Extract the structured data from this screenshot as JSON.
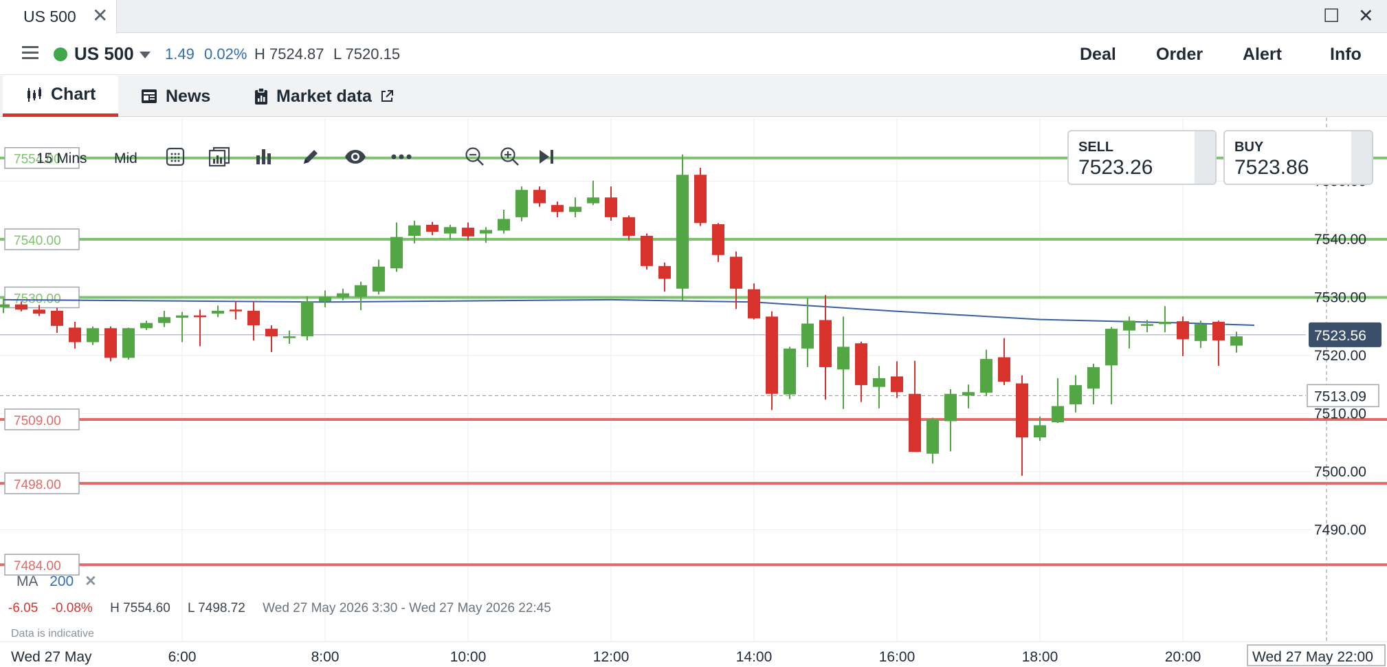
{
  "window": {
    "tab_title": "US 500",
    "close_glyph": "✕",
    "maximize_glyph": "☐",
    "close_window_glyph": "✕"
  },
  "instrument": {
    "name": "US 500",
    "status_color": "#3fa74a",
    "change": "1.49",
    "change_pct": "0.02%",
    "high_text": "H 7524.87",
    "low_text": "L 7520.15"
  },
  "actions": [
    "Deal",
    "Order",
    "Alert",
    "Info"
  ],
  "tabs": [
    {
      "label": "Chart",
      "icon": "candlestick-icon",
      "active": true
    },
    {
      "label": "News",
      "icon": "newspaper-icon",
      "active": false
    },
    {
      "label": "Market data",
      "icon": "market-data-icon",
      "active": false,
      "external": true
    }
  ],
  "toolbar": {
    "interval": "15 Mins",
    "price_type": "Mid",
    "icons": [
      "calculator-icon",
      "compare-icon",
      "chart-type-icon",
      "draw-pencil-icon",
      "visibility-eye-icon",
      "more-icon",
      "zoom-out-icon",
      "zoom-in-icon",
      "skip-to-end-icon"
    ]
  },
  "quote": {
    "sell_label": "SELL",
    "sell_value": "7523.26",
    "buy_label": "BUY",
    "buy_value": "7523.86"
  },
  "legend": {
    "ma_label": "MA",
    "ma_period": "200",
    "remove_glyph": "✕",
    "range_change": "-6.05",
    "range_change_pct": "-0.08%",
    "range_high": "H 7554.60",
    "range_low": "L 7498.72",
    "range_text": "Wed 27 May 2026 3:30 - Wed 27 May 2026 22:45",
    "indicative_note": "Data is indicative"
  },
  "chart_data": {
    "type": "candlestick",
    "interval": "15 Mins",
    "x_ticks": [
      "6:00",
      "8:00",
      "10:00",
      "12:00",
      "14:00",
      "16:00",
      "18:00",
      "20:00"
    ],
    "x_start_label": "Wed 27 May",
    "x_end_label": "Wed 27 May 22:00",
    "y_ticks": [
      7490,
      7500,
      7510,
      7520,
      7530,
      7540,
      7550
    ],
    "ylim": [
      7481,
      7558
    ],
    "current_price": 7523.56,
    "crosshair_price": 7513.09,
    "grid": true,
    "colors": {
      "up": "#52a644",
      "down": "#d8322d",
      "ma": "#3a5fa0",
      "support": "#e06a66",
      "resistance": "#7ec26f"
    },
    "level_lines": [
      {
        "value": 7554.0,
        "label": "7554.00",
        "kind": "resistance"
      },
      {
        "value": 7540.0,
        "label": "7540.00",
        "kind": "resistance"
      },
      {
        "value": 7530.0,
        "label": "7530.00",
        "kind": "resistance"
      },
      {
        "value": 7509.0,
        "label": "7509.00",
        "kind": "support"
      },
      {
        "value": 7498.0,
        "label": "7498.00",
        "kind": "support"
      },
      {
        "value": 7484.0,
        "label": "7484.00",
        "kind": "support"
      }
    ],
    "ma_200": [
      {
        "t": "3:30",
        "v": 7529.6
      },
      {
        "t": "8:00",
        "v": 7529.2
      },
      {
        "t": "12:00",
        "v": 7529.6
      },
      {
        "t": "14:00",
        "v": 7529.2
      },
      {
        "t": "16:00",
        "v": 7527.6
      },
      {
        "t": "18:00",
        "v": 7526.2
      },
      {
        "t": "20:00",
        "v": 7525.6
      },
      {
        "t": "21:00",
        "v": 7525.2
      }
    ],
    "candles": [
      {
        "t": "3:30",
        "o": 7528.3,
        "h": 7529.8,
        "l": 7527.3,
        "c": 7528.8
      },
      {
        "t": "3:45",
        "o": 7528.8,
        "h": 7529.3,
        "l": 7527.6,
        "c": 7527.9
      },
      {
        "t": "4:00",
        "o": 7527.9,
        "h": 7528.7,
        "l": 7526.8,
        "c": 7527.2
      },
      {
        "t": "4:15",
        "o": 7527.7,
        "h": 7528.2,
        "l": 7523.9,
        "c": 7525.1
      },
      {
        "t": "4:30",
        "o": 7524.8,
        "h": 7525.8,
        "l": 7521.2,
        "c": 7522.3
      },
      {
        "t": "4:45",
        "o": 7522.3,
        "h": 7525.0,
        "l": 7521.8,
        "c": 7524.7
      },
      {
        "t": "5:00",
        "o": 7524.7,
        "h": 7525.0,
        "l": 7519.0,
        "c": 7519.6
      },
      {
        "t": "5:15",
        "o": 7519.6,
        "h": 7524.8,
        "l": 7519.3,
        "c": 7524.7
      },
      {
        "t": "5:30",
        "o": 7524.7,
        "h": 7526.0,
        "l": 7524.4,
        "c": 7525.6
      },
      {
        "t": "5:45",
        "o": 7525.6,
        "h": 7527.7,
        "l": 7524.9,
        "c": 7526.6
      },
      {
        "t": "6:00",
        "o": 7526.5,
        "h": 7527.5,
        "l": 7522.3,
        "c": 7526.9
      },
      {
        "t": "6:15",
        "o": 7526.9,
        "h": 7527.9,
        "l": 7521.6,
        "c": 7526.6
      },
      {
        "t": "6:30",
        "o": 7527.2,
        "h": 7528.6,
        "l": 7526.6,
        "c": 7527.7
      },
      {
        "t": "6:45",
        "o": 7527.9,
        "h": 7529.3,
        "l": 7526.2,
        "c": 7527.7
      },
      {
        "t": "7:00",
        "o": 7527.7,
        "h": 7529.3,
        "l": 7522.6,
        "c": 7525.2
      },
      {
        "t": "7:15",
        "o": 7524.6,
        "h": 7525.2,
        "l": 7520.6,
        "c": 7523.3
      },
      {
        "t": "7:30",
        "o": 7523.0,
        "h": 7524.3,
        "l": 7522.0,
        "c": 7523.3
      },
      {
        "t": "7:45",
        "o": 7523.3,
        "h": 7530.2,
        "l": 7522.6,
        "c": 7529.3
      },
      {
        "t": "8:00",
        "o": 7529.3,
        "h": 7531.2,
        "l": 7528.3,
        "c": 7530.1
      },
      {
        "t": "8:15",
        "o": 7530.0,
        "h": 7531.5,
        "l": 7529.5,
        "c": 7530.7
      },
      {
        "t": "8:30",
        "o": 7530.1,
        "h": 7532.7,
        "l": 7527.8,
        "c": 7532.1
      },
      {
        "t": "8:45",
        "o": 7531.0,
        "h": 7536.5,
        "l": 7530.5,
        "c": 7535.3
      },
      {
        "t": "9:00",
        "o": 7535.0,
        "h": 7542.9,
        "l": 7534.4,
        "c": 7540.4
      },
      {
        "t": "9:15",
        "o": 7540.6,
        "h": 7543.2,
        "l": 7539.3,
        "c": 7542.4
      },
      {
        "t": "9:30",
        "o": 7542.5,
        "h": 7543.0,
        "l": 7540.7,
        "c": 7541.3
      },
      {
        "t": "9:45",
        "o": 7541.0,
        "h": 7542.5,
        "l": 7540.0,
        "c": 7542.1
      },
      {
        "t": "10:00",
        "o": 7542.0,
        "h": 7542.9,
        "l": 7539.8,
        "c": 7540.5
      },
      {
        "t": "10:15",
        "o": 7541.0,
        "h": 7542.1,
        "l": 7539.4,
        "c": 7541.6
      },
      {
        "t": "10:30",
        "o": 7541.5,
        "h": 7545.1,
        "l": 7541.0,
        "c": 7543.5
      },
      {
        "t": "10:45",
        "o": 7543.8,
        "h": 7549.1,
        "l": 7543.1,
        "c": 7548.5
      },
      {
        "t": "11:00",
        "o": 7548.5,
        "h": 7549.1,
        "l": 7545.6,
        "c": 7546.2
      },
      {
        "t": "11:15",
        "o": 7545.9,
        "h": 7546.5,
        "l": 7543.8,
        "c": 7544.7
      },
      {
        "t": "11:30",
        "o": 7544.7,
        "h": 7547.2,
        "l": 7543.8,
        "c": 7545.6
      },
      {
        "t": "11:45",
        "o": 7546.2,
        "h": 7550.1,
        "l": 7545.9,
        "c": 7547.2
      },
      {
        "t": "12:00",
        "o": 7547.2,
        "h": 7549.1,
        "l": 7543.2,
        "c": 7543.8
      },
      {
        "t": "12:15",
        "o": 7543.8,
        "h": 7544.1,
        "l": 7539.8,
        "c": 7540.6
      },
      {
        "t": "12:30",
        "o": 7540.6,
        "h": 7541.0,
        "l": 7534.8,
        "c": 7535.4
      },
      {
        "t": "12:45",
        "o": 7535.4,
        "h": 7536.0,
        "l": 7531.0,
        "c": 7533.2
      },
      {
        "t": "13:00",
        "o": 7531.5,
        "h": 7554.6,
        "l": 7529.5,
        "c": 7551.1
      },
      {
        "t": "13:15",
        "o": 7551.1,
        "h": 7552.3,
        "l": 7542.3,
        "c": 7542.8
      },
      {
        "t": "13:30",
        "o": 7542.6,
        "h": 7542.8,
        "l": 7536.1,
        "c": 7537.3
      },
      {
        "t": "13:45",
        "o": 7537.0,
        "h": 7537.9,
        "l": 7528.0,
        "c": 7531.5
      },
      {
        "t": "14:00",
        "o": 7531.4,
        "h": 7532.4,
        "l": 7526.2,
        "c": 7526.4
      },
      {
        "t": "14:15",
        "o": 7526.7,
        "h": 7527.6,
        "l": 7510.6,
        "c": 7513.4
      },
      {
        "t": "14:30",
        "o": 7513.3,
        "h": 7521.5,
        "l": 7512.5,
        "c": 7521.2
      },
      {
        "t": "14:45",
        "o": 7521.2,
        "h": 7529.9,
        "l": 7518.0,
        "c": 7525.5
      },
      {
        "t": "15:00",
        "o": 7526.1,
        "h": 7530.4,
        "l": 7512.4,
        "c": 7518.0
      },
      {
        "t": "15:15",
        "o": 7517.6,
        "h": 7526.7,
        "l": 7510.8,
        "c": 7521.5
      },
      {
        "t": "15:30",
        "o": 7522.1,
        "h": 7522.4,
        "l": 7512.0,
        "c": 7514.9
      },
      {
        "t": "15:45",
        "o": 7514.6,
        "h": 7518.2,
        "l": 7510.9,
        "c": 7516.1
      },
      {
        "t": "16:00",
        "o": 7516.4,
        "h": 7519.0,
        "l": 7512.7,
        "c": 7513.7
      },
      {
        "t": "16:15",
        "o": 7513.4,
        "h": 7519.1,
        "l": 7506.8,
        "c": 7503.4
      },
      {
        "t": "16:30",
        "o": 7503.1,
        "h": 7509.3,
        "l": 7501.4,
        "c": 7509.0
      },
      {
        "t": "16:45",
        "o": 7508.7,
        "h": 7514.2,
        "l": 7503.5,
        "c": 7513.4
      },
      {
        "t": "17:00",
        "o": 7513.1,
        "h": 7515.0,
        "l": 7510.9,
        "c": 7513.7
      },
      {
        "t": "17:15",
        "o": 7513.6,
        "h": 7521.0,
        "l": 7513.0,
        "c": 7519.4
      },
      {
        "t": "17:30",
        "o": 7519.7,
        "h": 7523.0,
        "l": 7514.9,
        "c": 7515.5
      },
      {
        "t": "17:45",
        "o": 7515.2,
        "h": 7516.6,
        "l": 7499.3,
        "c": 7505.9
      },
      {
        "t": "18:00",
        "o": 7505.9,
        "h": 7509.5,
        "l": 7505.3,
        "c": 7508.0
      },
      {
        "t": "18:15",
        "o": 7508.5,
        "h": 7516.1,
        "l": 7508.4,
        "c": 7511.3
      },
      {
        "t": "18:30",
        "o": 7511.6,
        "h": 7516.6,
        "l": 7510.2,
        "c": 7514.9
      },
      {
        "t": "18:45",
        "o": 7514.3,
        "h": 7518.6,
        "l": 7511.6,
        "c": 7518.0
      },
      {
        "t": "19:00",
        "o": 7518.3,
        "h": 7524.9,
        "l": 7511.6,
        "c": 7524.6
      },
      {
        "t": "19:15",
        "o": 7524.3,
        "h": 7526.7,
        "l": 7521.2,
        "c": 7526.0
      },
      {
        "t": "19:30",
        "o": 7525.4,
        "h": 7526.1,
        "l": 7524.0,
        "c": 7525.4
      },
      {
        "t": "19:45",
        "o": 7525.4,
        "h": 7528.5,
        "l": 7524.0,
        "c": 7525.8
      },
      {
        "t": "20:00",
        "o": 7525.9,
        "h": 7526.7,
        "l": 7519.9,
        "c": 7522.8
      },
      {
        "t": "20:15",
        "o": 7522.5,
        "h": 7526.0,
        "l": 7521.3,
        "c": 7525.4
      },
      {
        "t": "20:30",
        "o": 7525.8,
        "h": 7526.0,
        "l": 7518.2,
        "c": 7522.6
      },
      {
        "t": "20:45",
        "o": 7521.7,
        "h": 7524.1,
        "l": 7520.5,
        "c": 7523.3
      }
    ]
  }
}
